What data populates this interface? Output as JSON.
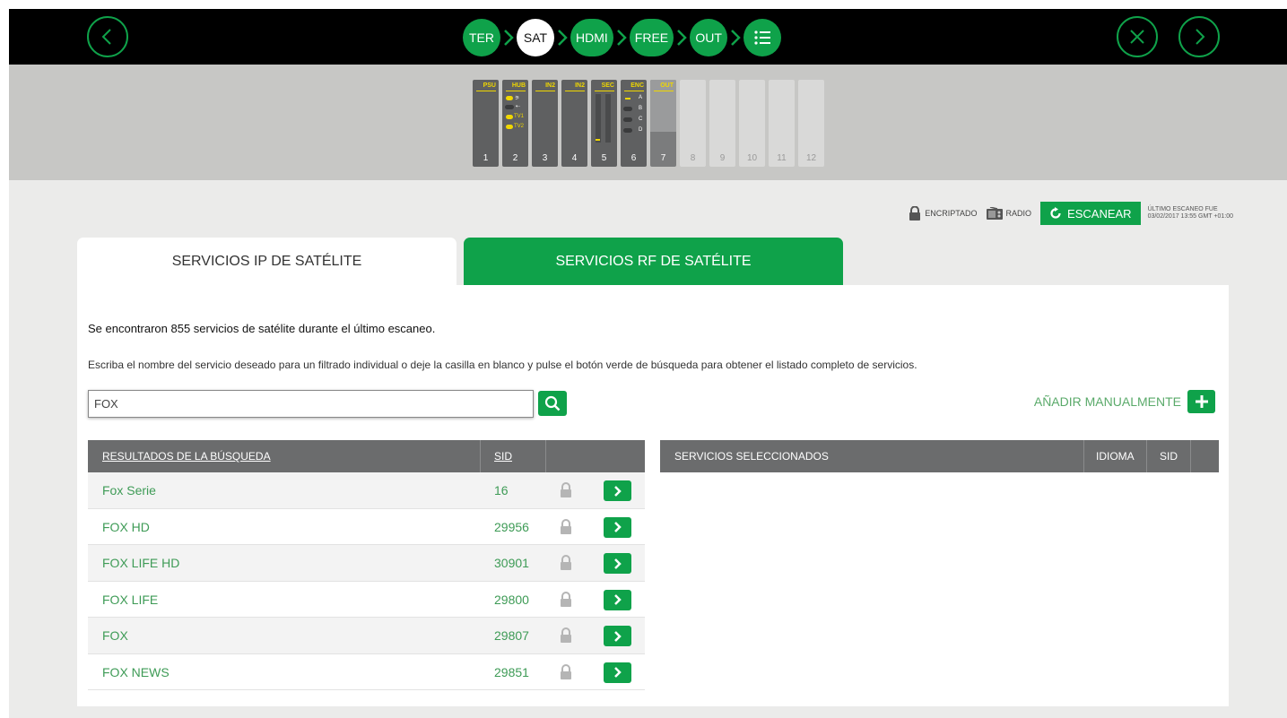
{
  "colors": {
    "accent": "#0fa24a",
    "rack_label": "#f0d700",
    "header_bg": "#6b6c6d"
  },
  "topbar": {
    "back_icon": "chevron-left-icon",
    "close_icon": "close-icon",
    "next_icon": "chevron-right-icon",
    "steps": [
      {
        "label": "TER",
        "active": false
      },
      {
        "label": "SAT",
        "active": true
      },
      {
        "label": "HDMI",
        "active": false
      },
      {
        "label": "FREE",
        "active": false
      },
      {
        "label": "OUT",
        "active": false
      }
    ],
    "summary_icon": "list-icon"
  },
  "rack": {
    "slots": [
      {
        "label": "PSU",
        "num": "1"
      },
      {
        "label": "HUB",
        "num": "2",
        "ports": [
          "TV1",
          "TV2"
        ]
      },
      {
        "label": "IN2",
        "num": "3"
      },
      {
        "label": "IN2",
        "num": "4"
      },
      {
        "label": "SEC",
        "num": "5"
      },
      {
        "label": "ENC",
        "num": "6",
        "channels": [
          "A",
          "B",
          "C",
          "D"
        ]
      },
      {
        "label": "OUT",
        "num": "7"
      },
      {
        "label": "",
        "num": "8"
      },
      {
        "label": "",
        "num": "9"
      },
      {
        "label": "",
        "num": "10"
      },
      {
        "label": "",
        "num": "11"
      },
      {
        "label": "",
        "num": "12"
      }
    ]
  },
  "status": {
    "encrypted_label": "ENCRIPTADO",
    "radio_label": "RADIO",
    "scan_button": "ESCANEAR",
    "last_scan_line1": "ÚLTIMO ESCANEO FUE",
    "last_scan_line2": "03/02/2017 13:55 GMT +01:00"
  },
  "tabs": {
    "ip": "SERVICIOS IP DE SATÉLITE",
    "rf": "SERVICIOS RF DE SATÉLITE"
  },
  "panel": {
    "info_found": "Se encontraron 855 servicios de satélite durante el último escaneo.",
    "info_instructions": "Escriba el nombre del servicio deseado para un filtrado individual o deje la casilla en blanco y pulse el botón verde de búsqueda para obtener el listado completo de servicios.",
    "search_value": "FOX",
    "add_manual": "AÑADIR MANUALMENTE"
  },
  "results": {
    "header_name": "RESULTADOS DE LA BÚSQUEDA",
    "header_sid": "SID",
    "rows": [
      {
        "name": "Fox Serie",
        "sid": "16"
      },
      {
        "name": "FOX HD",
        "sid": "29956"
      },
      {
        "name": "FOX LIFE HD",
        "sid": "30901"
      },
      {
        "name": "FOX LIFE",
        "sid": "29800"
      },
      {
        "name": "FOX",
        "sid": "29807"
      },
      {
        "name": "FOX NEWS",
        "sid": "29851"
      }
    ]
  },
  "selected": {
    "header_title": "SERVICIOS SELECCIONADOS",
    "header_lang": "IDIOMA",
    "header_sid": "SID"
  }
}
